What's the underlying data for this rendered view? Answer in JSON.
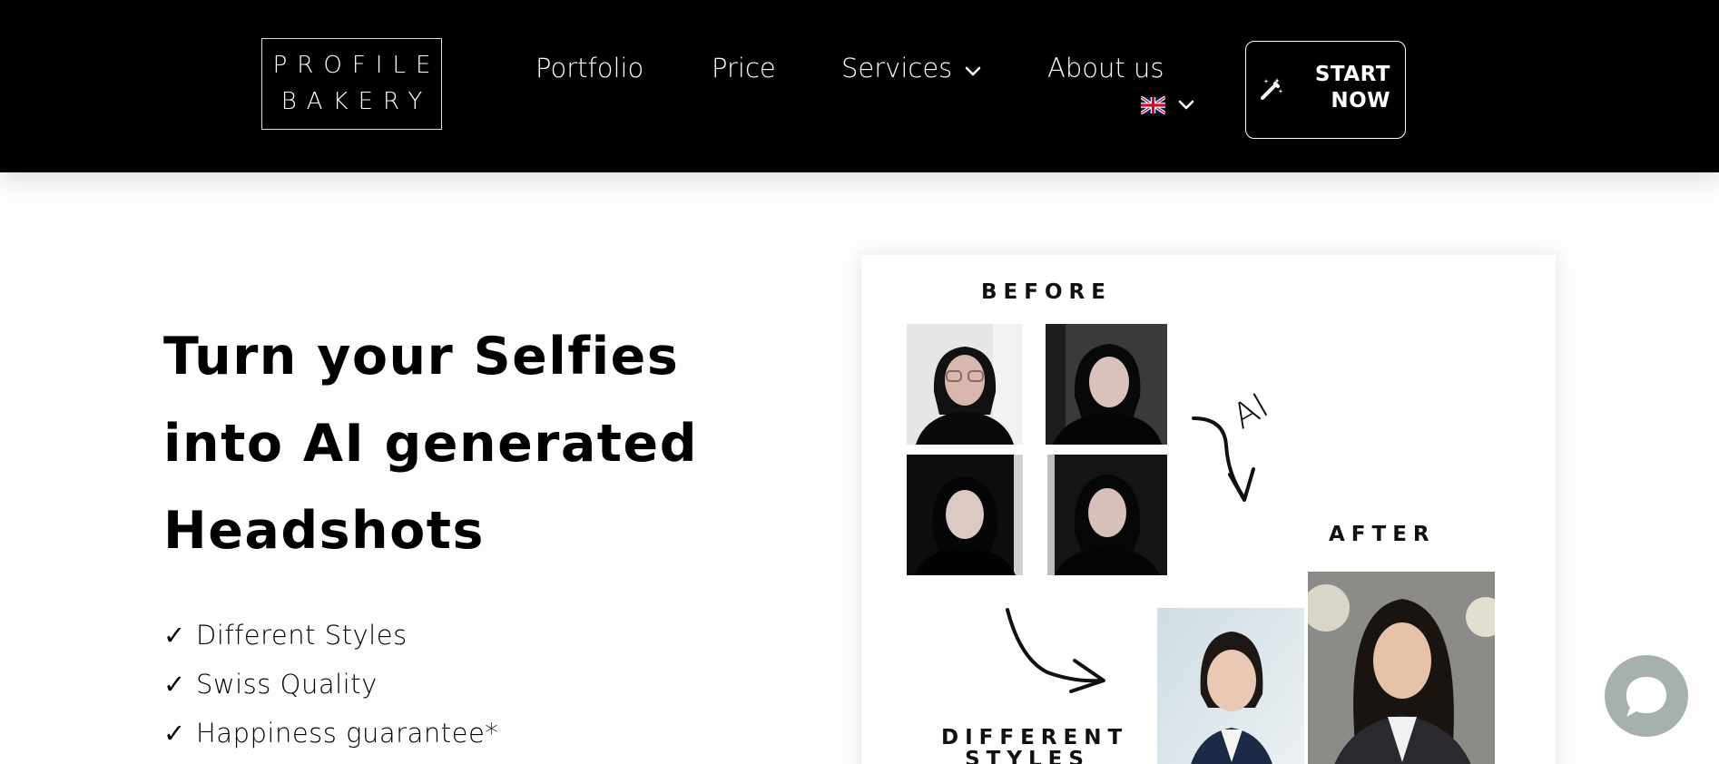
{
  "header": {
    "logo": {
      "line1": "PROFILE",
      "line2": "BAKERY"
    },
    "nav": {
      "portfolio": "Portfolio",
      "price": "Price",
      "services": "Services",
      "about": "About us"
    },
    "language": {
      "icon": "uk-flag-icon",
      "selected": "English"
    },
    "cta": {
      "line1": "START",
      "line2": "NOW",
      "icon": "magic-wand-icon"
    }
  },
  "hero": {
    "headline_lines": [
      "Turn your Selfies",
      "into AI generated",
      "Headshots"
    ],
    "features": [
      "Different Styles",
      "Swiss Quality",
      "Happiness guarantee*"
    ],
    "check_symbol": "✓"
  },
  "card": {
    "before_label": "BEFORE",
    "after_label": "AFTER",
    "different_styles_label": "DIFFERENT STYLES",
    "ai_label": "AI"
  },
  "chat": {
    "icon": "chat-bubble-icon"
  },
  "colors": {
    "header_bg": "#000000",
    "page_bg": "#fdfdfd",
    "chat_bg": "#a6b1ad"
  }
}
